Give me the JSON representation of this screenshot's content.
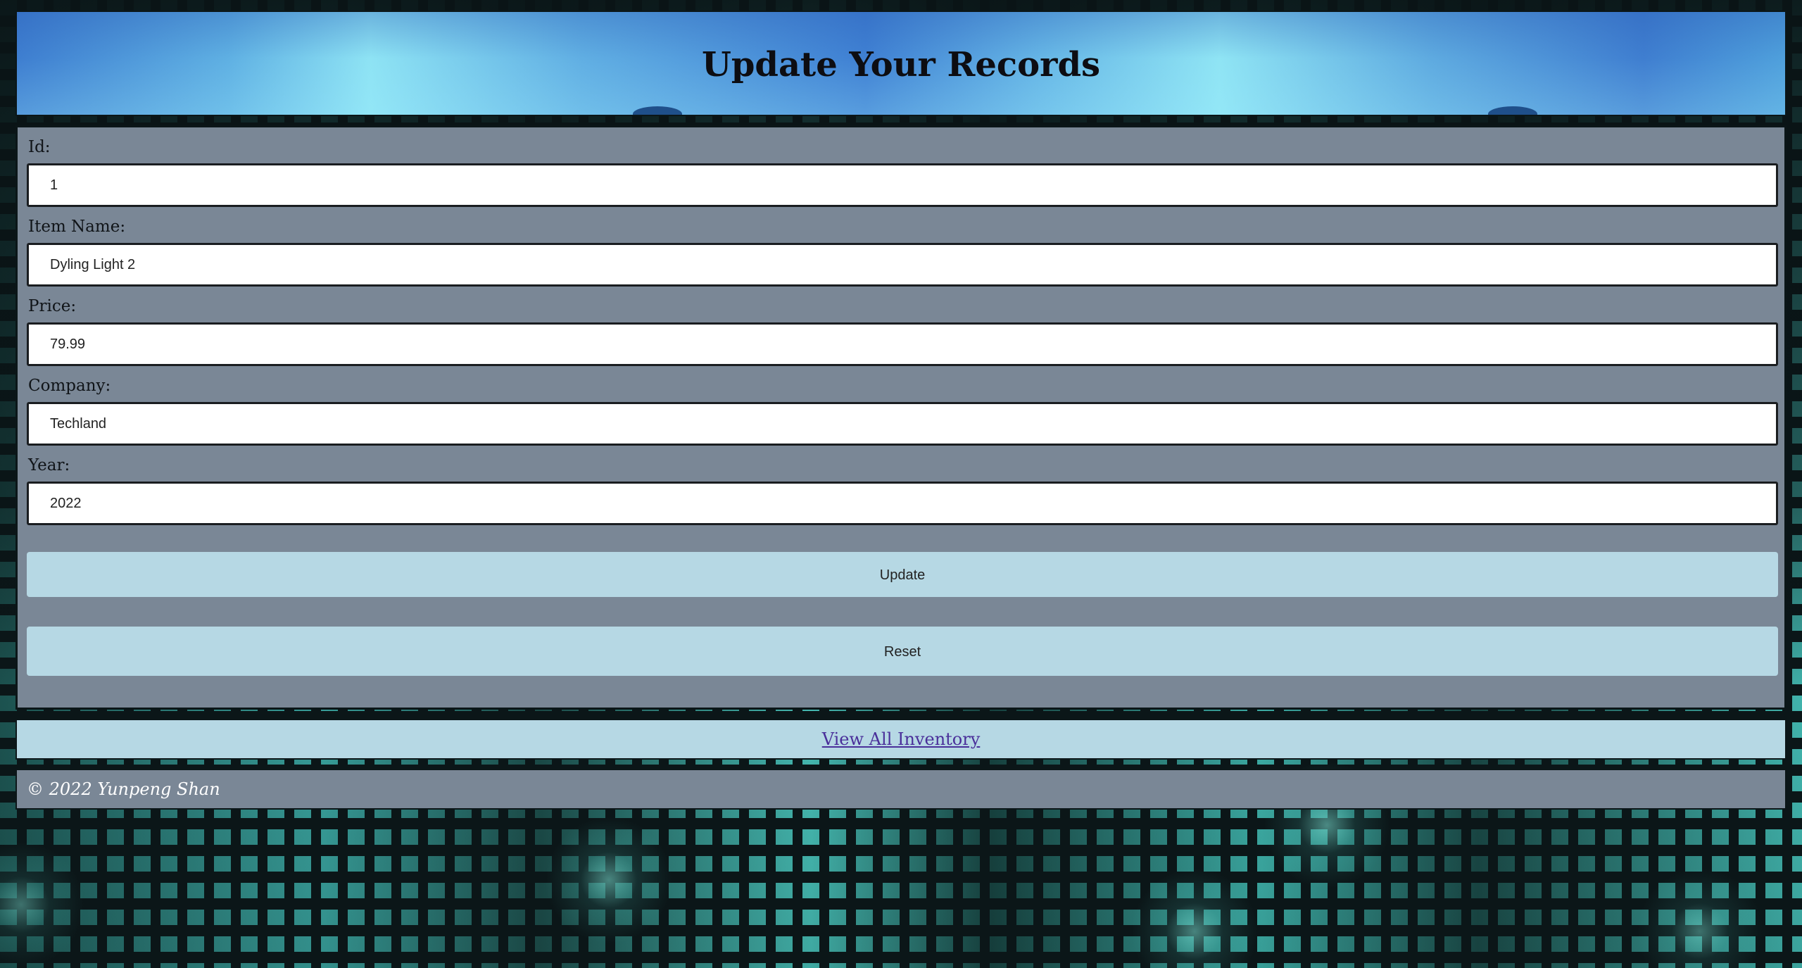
{
  "header": {
    "title": "Update Your Records"
  },
  "form": {
    "fields": [
      {
        "label": "Id:",
        "value": "1"
      },
      {
        "label": "Item Name:",
        "value": "Dyling Light 2"
      },
      {
        "label": "Price:",
        "value": "79.99"
      },
      {
        "label": "Company:",
        "value": "Techland"
      },
      {
        "label": "Year:",
        "value": "2022"
      }
    ],
    "update_label": "Update",
    "reset_label": "Reset"
  },
  "nav": {
    "view_all_label": "View All Inventory"
  },
  "footer": {
    "copyright": "© 2022 Yunpeng Shan"
  },
  "colors": {
    "panel": "#7a8796",
    "button": "#b6d8e4",
    "link": "#4a2f9a"
  }
}
